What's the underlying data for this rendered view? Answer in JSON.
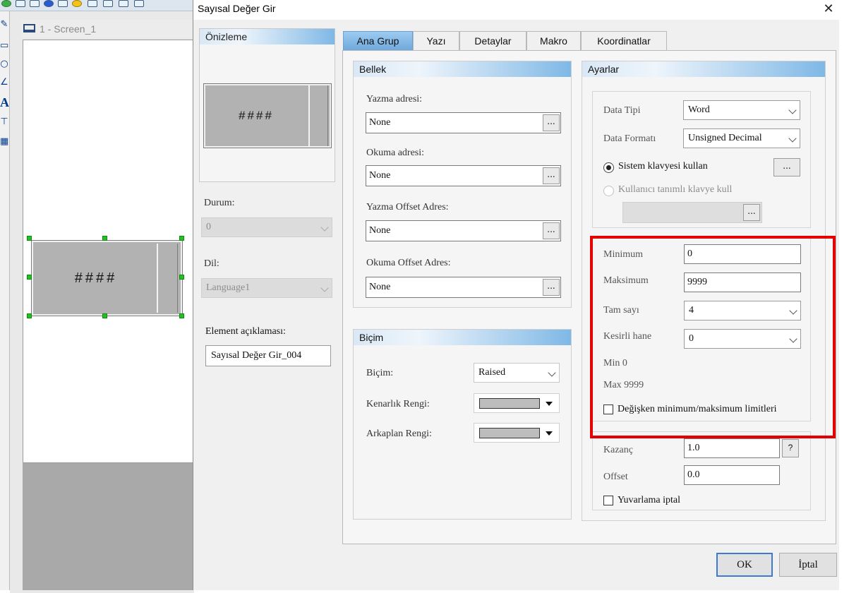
{
  "editor": {
    "screen_tab_label": "1 - Screen_1",
    "canvas_element_text": "####"
  },
  "dialog": {
    "title": "Sayısal Değer Gir",
    "close_symbol": "✕",
    "preview": {
      "header": "Önizleme",
      "element_text": "####"
    },
    "status": {
      "label": "Durum:",
      "value": "0"
    },
    "language": {
      "label": "Dil:",
      "value": "Language1"
    },
    "description": {
      "label": "Element açıklaması:",
      "value": "Sayısal Değer Gir_004"
    },
    "tabs": [
      {
        "label": "Ana Grup",
        "active": true
      },
      {
        "label": "Yazı",
        "active": false
      },
      {
        "label": "Detaylar",
        "active": false
      },
      {
        "label": "Makro",
        "active": false
      },
      {
        "label": "Koordinatlar",
        "active": false
      }
    ],
    "memory": {
      "header": "Bellek",
      "browse_label": "...",
      "fields": [
        {
          "label": "Yazma adresi:",
          "value": "None"
        },
        {
          "label": "Okuma adresi:",
          "value": "None"
        },
        {
          "label": "Yazma Offset Adres:",
          "value": "None"
        },
        {
          "label": "Okuma Offset Adres:",
          "value": "None"
        }
      ]
    },
    "format": {
      "header": "Biçim",
      "style_label": "Biçim:",
      "style_value": "Raised",
      "border_color_label": "Kenarlık Rengi:",
      "background_color_label": "Arkaplan Rengi:",
      "border_color": "#bdbdbd",
      "background_color": "#bdbdbd"
    },
    "settings": {
      "header": "Ayarlar",
      "data_type_label": "Data Tipi",
      "data_type_value": "Word",
      "data_format_label": "Data Formatı",
      "data_format_value": "Unsigned Decimal",
      "system_keyboard_label": "Sistem klavyesi kullan",
      "custom_keyboard_label": "Kullanıcı tanımlı klavye kull",
      "browse_label": "...",
      "minimum_label": "Minimum",
      "minimum_value": "0",
      "maximum_label": "Maksimum",
      "maximum_value": "9999",
      "integer_label": "Tam sayı",
      "integer_value": "4",
      "decimal_label": "Kesirli hane",
      "decimal_value": "0",
      "min_display": "Min 0",
      "max_display": "Max 9999",
      "variable_limits_label": "Değişken minimum/maksimum limitleri",
      "gain_label": "Kazanç",
      "gain_value": "1.0",
      "help_label": "?",
      "offset_label": "Offset",
      "offset_value": "0.0",
      "no_rounding_label": "Yuvarlama iptal"
    },
    "buttons": {
      "ok": "OK",
      "cancel": "İptal"
    },
    "highlight_color": "#e40000"
  }
}
